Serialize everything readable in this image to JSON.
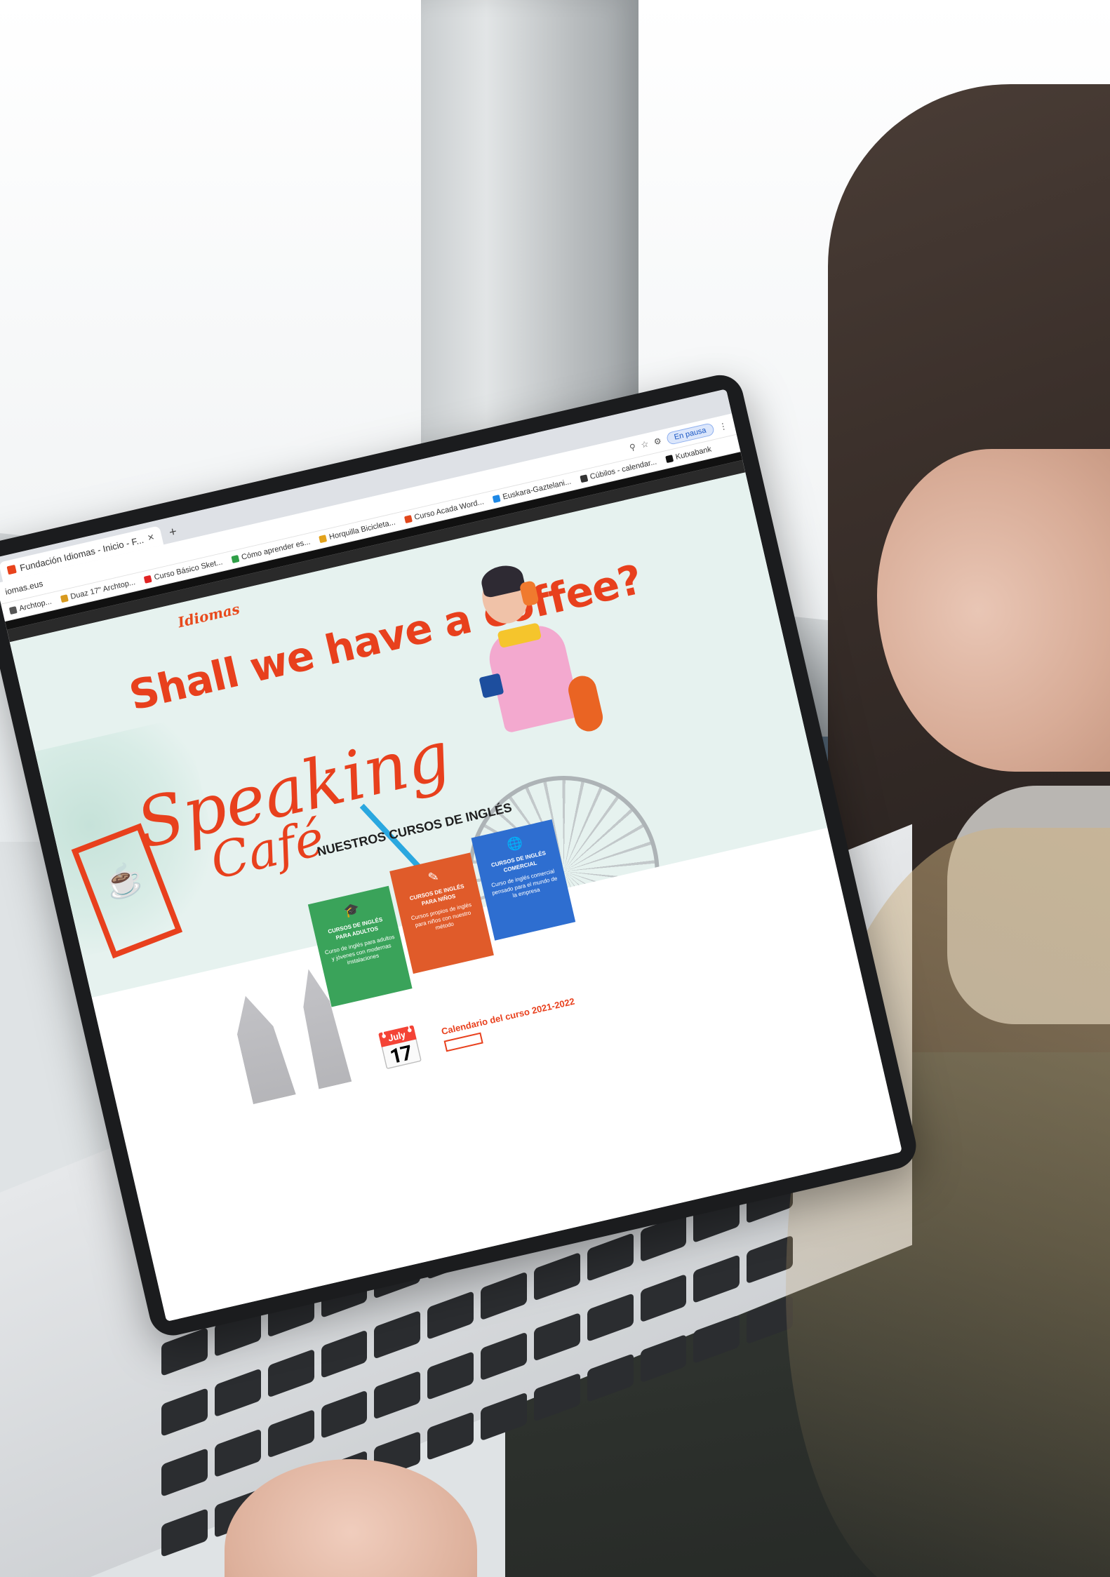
{
  "browser": {
    "tabs": [
      {
        "label": "Fundación Idiomas - Inicio - F..."
      }
    ],
    "new_tab_symbol": "+",
    "close_symbol": "✕",
    "address": "iomas.eus",
    "paused_label": "En pausa",
    "bookmarks": [
      {
        "label": "Archtop...",
        "color": "#555555"
      },
      {
        "label": "Duaz 17\" Archtop...",
        "color": "#d89a1f"
      },
      {
        "label": "Curso Básico Sket...",
        "color": "#e12424"
      },
      {
        "label": "Cómo aprender es...",
        "color": "#2f9f47"
      },
      {
        "label": "Horquilla Bicicleta...",
        "color": "#e3a21b"
      },
      {
        "label": "Curso Acada Word...",
        "color": "#e1471b"
      },
      {
        "label": "Euskara-Gaztelani...",
        "color": "#1e88e5"
      },
      {
        "label": "Cúbilos - calendar...",
        "color": "#333333"
      },
      {
        "label": "Kutxabank",
        "color": "#111111"
      }
    ]
  },
  "site": {
    "logo": "Idiomas",
    "hero_title": "Shall we have a coffee?",
    "speaking": "Speaking",
    "cafe": "Café",
    "section_title": "NUESTROS CURSOS DE INGLÉS",
    "cards": [
      {
        "title": "CURSOS DE INGLÉS PARA ADULTOS",
        "body": "Curso de inglés para adultos y jóvenes con modernas instalaciones",
        "color": "#3aa35a",
        "icon": "graduation-cap-icon"
      },
      {
        "title": "CURSOS DE INGLÉS PARA NIÑOS",
        "body": "Cursos propios de inglés para niños con nuestro método",
        "color": "#e05b2a",
        "icon": "pencil-icon"
      },
      {
        "title": "CURSOS DE INGLÉS COMERCIAL",
        "body": "Curso de inglés comercial pensado para el mundo de la empresa",
        "color": "#2e6ed0",
        "icon": "globe-icon"
      }
    ],
    "calendar_title": "Calendario del curso 2021-2022"
  },
  "colors": {
    "brand_red": "#e8401d",
    "hero_bg": "#e6f2ef"
  }
}
